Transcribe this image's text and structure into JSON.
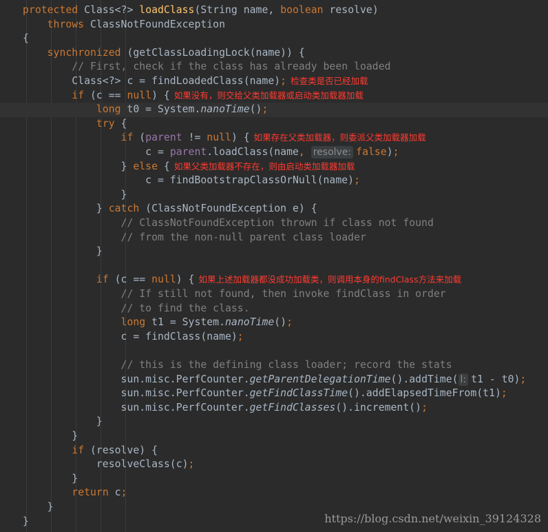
{
  "editor": {
    "colors": {
      "background": "#2b2b2b",
      "keyword": "#cc7832",
      "method": "#ffc66d",
      "comment": "#808080",
      "field": "#9876aa",
      "annotation": "#ff3b30"
    },
    "lines": [
      {
        "tokens": [
          {
            "t": "kw",
            "v": "protected "
          },
          {
            "t": "pl",
            "v": "Class<?> "
          },
          {
            "t": "fn",
            "v": "loadClass"
          },
          {
            "t": "pl",
            "v": "(String name, "
          },
          {
            "t": "kw",
            "v": "boolean "
          },
          {
            "t": "pl",
            "v": "resolve)"
          }
        ]
      },
      {
        "tokens": [
          {
            "t": "pl",
            "v": "    "
          },
          {
            "t": "kw",
            "v": "throws "
          },
          {
            "t": "pl",
            "v": "ClassNotFoundException"
          }
        ]
      },
      {
        "tokens": [
          {
            "t": "pl",
            "v": "{"
          }
        ]
      },
      {
        "tokens": [
          {
            "t": "pl",
            "v": "    "
          },
          {
            "t": "kw",
            "v": "synchronized "
          },
          {
            "t": "pl",
            "v": "(getClassLoadingLock(name)) {"
          }
        ]
      },
      {
        "tokens": [
          {
            "t": "pl",
            "v": "        "
          },
          {
            "t": "cm",
            "v": "// First, check if the class has already been loaded"
          }
        ]
      },
      {
        "tokens": [
          {
            "t": "pl",
            "v": "        Class<?> c = findLoadedClass(name)"
          },
          {
            "t": "kw",
            "v": ";"
          }
        ],
        "note": "检查类是否已经加载"
      },
      {
        "tokens": [
          {
            "t": "pl",
            "v": "        "
          },
          {
            "t": "kw",
            "v": "if "
          },
          {
            "t": "pl",
            "v": "(c == "
          },
          {
            "t": "kw",
            "v": "null"
          },
          {
            "t": "pl",
            "v": ") {"
          }
        ],
        "note": "如果没有，则交给父类加载器或启动类加载器加载"
      },
      {
        "hl": true,
        "tokens": [
          {
            "t": "pl",
            "v": "            "
          },
          {
            "t": "kw",
            "v": "long "
          },
          {
            "t": "pl",
            "v": "t0 = System."
          },
          {
            "t": "it",
            "v": "nanoTime"
          },
          {
            "t": "pl",
            "v": "()"
          },
          {
            "t": "kw",
            "v": ";"
          }
        ]
      },
      {
        "tokens": [
          {
            "t": "pl",
            "v": "            "
          },
          {
            "t": "kw",
            "v": "try "
          },
          {
            "t": "pl",
            "v": "{"
          }
        ]
      },
      {
        "tokens": [
          {
            "t": "pl",
            "v": "                "
          },
          {
            "t": "kw",
            "v": "if "
          },
          {
            "t": "pl",
            "v": "("
          },
          {
            "t": "ph",
            "v": "parent "
          },
          {
            "t": "pl",
            "v": "!= "
          },
          {
            "t": "kw",
            "v": "null"
          },
          {
            "t": "pl",
            "v": ") {"
          }
        ],
        "note": "如果存在父类加载器，则委派父类加载器加载"
      },
      {
        "tokens": [
          {
            "t": "pl",
            "v": "                    c = "
          },
          {
            "t": "ph",
            "v": "parent"
          },
          {
            "t": "pl",
            "v": ".loadClass(name"
          },
          {
            "t": "kw",
            "v": ", "
          },
          {
            "t": "hint",
            "v": "resolve:"
          },
          {
            "t": "kw",
            "v": "false"
          },
          {
            "t": "pl",
            "v": ")"
          },
          {
            "t": "kw",
            "v": ";"
          }
        ]
      },
      {
        "tokens": [
          {
            "t": "pl",
            "v": "                } "
          },
          {
            "t": "kw",
            "v": "else "
          },
          {
            "t": "pl",
            "v": "{"
          }
        ],
        "note": "如果父类加载器不存在，则由启动类加载器加载"
      },
      {
        "tokens": [
          {
            "t": "pl",
            "v": "                    c = findBootstrapClassOrNull(name)"
          },
          {
            "t": "kw",
            "v": ";"
          }
        ]
      },
      {
        "tokens": [
          {
            "t": "pl",
            "v": "                }"
          }
        ]
      },
      {
        "tokens": [
          {
            "t": "pl",
            "v": "            } "
          },
          {
            "t": "kw",
            "v": "catch "
          },
          {
            "t": "pl",
            "v": "(ClassNotFoundException e) {"
          }
        ]
      },
      {
        "tokens": [
          {
            "t": "pl",
            "v": "                "
          },
          {
            "t": "cm",
            "v": "// ClassNotFoundException thrown if class not found"
          }
        ]
      },
      {
        "tokens": [
          {
            "t": "pl",
            "v": "                "
          },
          {
            "t": "cm",
            "v": "// from the non-null parent class loader"
          }
        ]
      },
      {
        "tokens": [
          {
            "t": "pl",
            "v": "            }"
          }
        ]
      },
      {
        "tokens": []
      },
      {
        "tokens": [
          {
            "t": "pl",
            "v": "            "
          },
          {
            "t": "kw",
            "v": "if "
          },
          {
            "t": "pl",
            "v": "(c == "
          },
          {
            "t": "kw",
            "v": "null"
          },
          {
            "t": "pl",
            "v": ") {"
          }
        ],
        "note": "如果上述加载器都没成功加载类，则调用本身的findClass方法来加载"
      },
      {
        "tokens": [
          {
            "t": "pl",
            "v": "                "
          },
          {
            "t": "cm",
            "v": "// If still not found, then invoke findClass in order"
          }
        ]
      },
      {
        "tokens": [
          {
            "t": "pl",
            "v": "                "
          },
          {
            "t": "cm",
            "v": "// to find the class."
          }
        ]
      },
      {
        "tokens": [
          {
            "t": "pl",
            "v": "                "
          },
          {
            "t": "kw",
            "v": "long "
          },
          {
            "t": "pl",
            "v": "t1 = System."
          },
          {
            "t": "it",
            "v": "nanoTime"
          },
          {
            "t": "pl",
            "v": "()"
          },
          {
            "t": "kw",
            "v": ";"
          }
        ]
      },
      {
        "tokens": [
          {
            "t": "pl",
            "v": "                c = findClass(name)"
          },
          {
            "t": "kw",
            "v": ";"
          }
        ]
      },
      {
        "tokens": []
      },
      {
        "tokens": [
          {
            "t": "pl",
            "v": "                "
          },
          {
            "t": "cm",
            "v": "// this is the defining class loader; record the stats"
          }
        ]
      },
      {
        "tokens": [
          {
            "t": "pl",
            "v": "                sun.misc.PerfCounter."
          },
          {
            "t": "it",
            "v": "getParentDelegationTime"
          },
          {
            "t": "pl",
            "v": "().addTime("
          },
          {
            "t": "hint",
            "v": "l:"
          },
          {
            "t": "pl",
            "v": "t1 - t0)"
          },
          {
            "t": "kw",
            "v": ";"
          }
        ]
      },
      {
        "tokens": [
          {
            "t": "pl",
            "v": "                sun.misc.PerfCounter."
          },
          {
            "t": "it",
            "v": "getFindClassTime"
          },
          {
            "t": "pl",
            "v": "().addElapsedTimeFrom(t1)"
          },
          {
            "t": "kw",
            "v": ";"
          }
        ]
      },
      {
        "tokens": [
          {
            "t": "pl",
            "v": "                sun.misc.PerfCounter."
          },
          {
            "t": "it",
            "v": "getFindClasses"
          },
          {
            "t": "pl",
            "v": "().increment()"
          },
          {
            "t": "kw",
            "v": ";"
          }
        ]
      },
      {
        "tokens": [
          {
            "t": "pl",
            "v": "            }"
          }
        ]
      },
      {
        "tokens": [
          {
            "t": "pl",
            "v": "        }"
          }
        ]
      },
      {
        "tokens": [
          {
            "t": "pl",
            "v": "        "
          },
          {
            "t": "kw",
            "v": "if "
          },
          {
            "t": "pl",
            "v": "(resolve) {"
          }
        ]
      },
      {
        "tokens": [
          {
            "t": "pl",
            "v": "            resolveClass(c)"
          },
          {
            "t": "kw",
            "v": ";"
          }
        ]
      },
      {
        "tokens": [
          {
            "t": "pl",
            "v": "        }"
          }
        ]
      },
      {
        "tokens": [
          {
            "t": "pl",
            "v": "        "
          },
          {
            "t": "kw",
            "v": "return "
          },
          {
            "t": "pl",
            "v": "c"
          },
          {
            "t": "kw",
            "v": ";"
          }
        ]
      },
      {
        "tokens": [
          {
            "t": "pl",
            "v": "    }"
          }
        ]
      },
      {
        "tokens": [
          {
            "t": "pl",
            "v": "}"
          }
        ]
      }
    ]
  },
  "watermark": "https://blog.csdn.net/weixin_39124328"
}
